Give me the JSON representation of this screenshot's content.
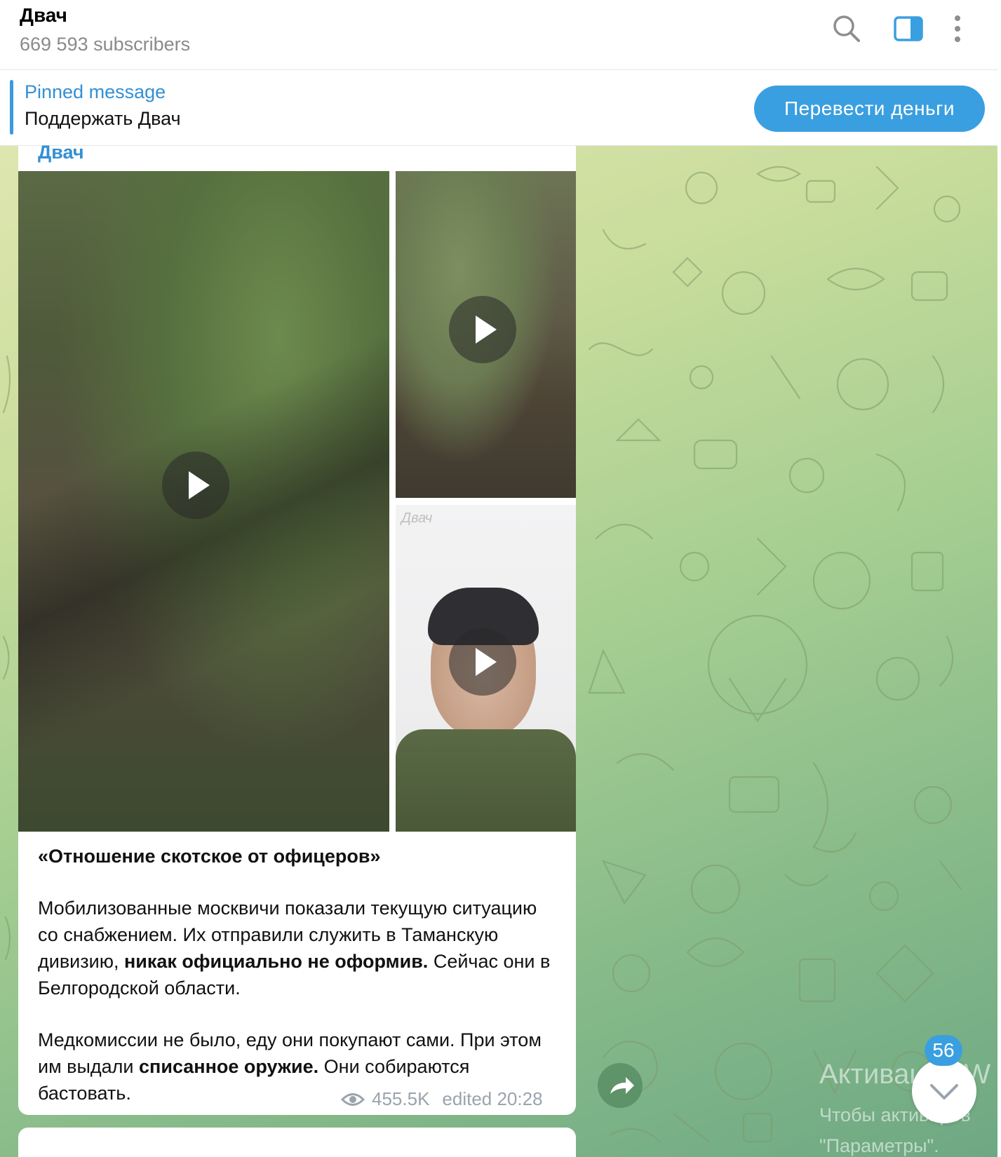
{
  "header": {
    "channel_name": "Двач",
    "subscribers": "669 593 subscribers",
    "icons": [
      "search-icon",
      "side-panel-icon",
      "more-vertical-icon"
    ]
  },
  "pinned": {
    "title": "Pinned message",
    "text": "Поддержать Двач",
    "button_label": "Перевести деньги"
  },
  "message": {
    "sender": "Двач",
    "media_watermark": "Двач",
    "caption_title": "«Отношение скотское от офицеров»",
    "paragraph1_part1": "Мобилизованные москвичи показали текущую ситуацию со снабжением. Их отправили служить в Таманскую дивизию, ",
    "paragraph1_bold": "никак официально не оформив.",
    "paragraph1_part2": " Сейчас они в Белгородской области.",
    "paragraph2_part1": "Медкомиссии не было, еду они покупают сами. При этом им выдали ",
    "paragraph2_bold": "списанное оружие.",
    "paragraph2_part2": " Они собираются бастовать.",
    "views": "455.5K",
    "edited": "edited 20:28"
  },
  "controls": {
    "unread_count": "56"
  },
  "overlay": {
    "activation_title": "Активация W",
    "activation_line1": "Чтобы активиров",
    "activation_line2": "\"Параметры\"."
  },
  "colors": {
    "accent": "#3a9fe0",
    "link": "#3390d3"
  }
}
